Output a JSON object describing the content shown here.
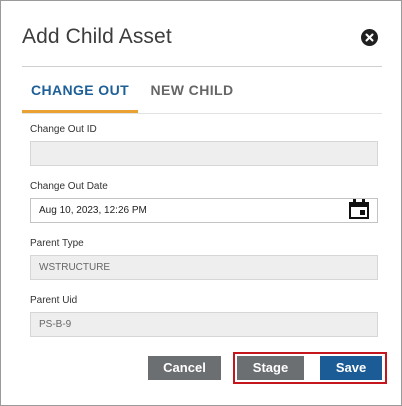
{
  "dialog": {
    "title": "Add Child Asset",
    "close_icon": "close-circle-icon"
  },
  "tabs": [
    {
      "label": "CHANGE OUT",
      "active": true
    },
    {
      "label": "NEW CHILD",
      "active": false
    }
  ],
  "fields": {
    "change_out_id": {
      "label": "Change Out ID",
      "value": ""
    },
    "change_out_date": {
      "label": "Change Out Date",
      "value": "Aug 10, 2023, 12:26 PM",
      "icon": "calendar-icon"
    },
    "parent_type": {
      "label": "Parent Type",
      "value": "WSTRUCTURE"
    },
    "parent_uid": {
      "label": "Parent Uid",
      "value": "PS-B-9"
    }
  },
  "buttons": {
    "cancel": "Cancel",
    "stage": "Stage",
    "save": "Save"
  },
  "colors": {
    "primary": "#1c5c96",
    "tab_indicator": "#e9a231",
    "secondary_button": "#6c6f72",
    "highlight": "#c4161c"
  }
}
